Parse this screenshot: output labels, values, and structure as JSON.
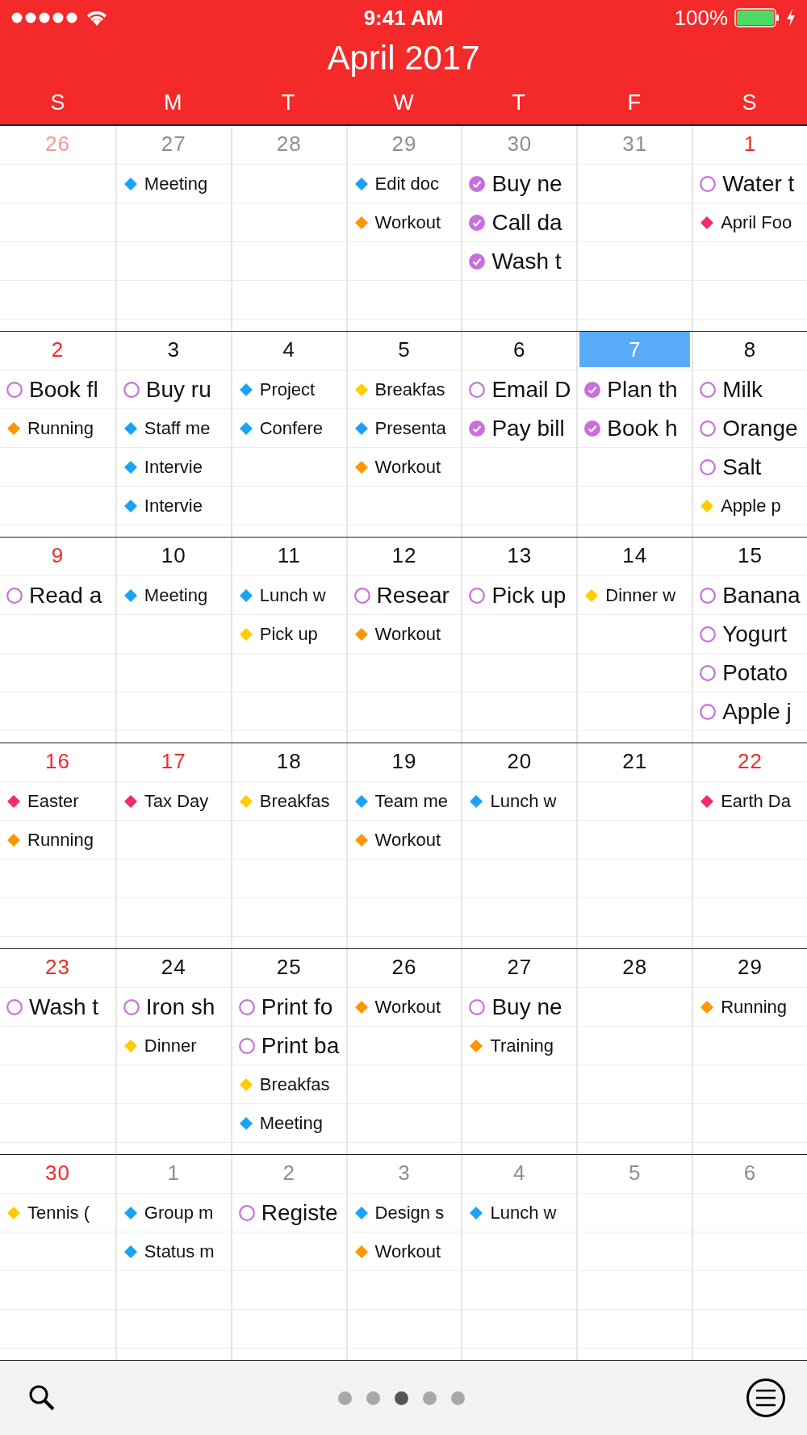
{
  "status_bar": {
    "time": "9:41 AM",
    "battery": "100%"
  },
  "header": {
    "title": "April 2017",
    "weekdays": [
      "S",
      "M",
      "T",
      "W",
      "T",
      "F",
      "S"
    ]
  },
  "weeks": [
    {
      "days": [
        {
          "number": "26",
          "other_month": true,
          "red": true,
          "selected": false
        },
        {
          "number": "27",
          "other_month": true,
          "red": false,
          "selected": false,
          "items": [
            {
              "kind": "event",
              "color": "#1aa3f5",
              "text": "Meeting"
            }
          ]
        },
        {
          "number": "28",
          "other_month": true,
          "red": false,
          "selected": false
        },
        {
          "number": "29",
          "other_month": true,
          "red": false,
          "selected": false,
          "items": [
            {
              "kind": "event",
              "color": "#1aa3f5",
              "text": "Edit doc"
            },
            {
              "kind": "event",
              "color": "#ff9500",
              "text": "Workout"
            }
          ]
        },
        {
          "number": "30",
          "other_month": true,
          "red": false,
          "selected": false,
          "items": [
            {
              "kind": "task",
              "done": true,
              "text": "Buy ne"
            },
            {
              "kind": "task",
              "done": true,
              "text": "Call da"
            },
            {
              "kind": "task",
              "done": true,
              "text": "Wash t"
            }
          ]
        },
        {
          "number": "31",
          "other_month": true,
          "red": false,
          "selected": false
        },
        {
          "number": "1",
          "other_month": false,
          "red": true,
          "selected": false,
          "items": [
            {
              "kind": "task",
              "done": false,
              "text": "Water t"
            },
            {
              "kind": "event",
              "color": "#f52b67",
              "text": "April Foo"
            }
          ]
        }
      ]
    },
    {
      "days": [
        {
          "number": "2",
          "other_month": false,
          "red": true,
          "selected": false,
          "items": [
            {
              "kind": "task",
              "done": false,
              "text": "Book fl"
            },
            {
              "kind": "event",
              "color": "#ff9500",
              "text": "Running"
            }
          ]
        },
        {
          "number": "3",
          "other_month": false,
          "red": false,
          "selected": false,
          "items": [
            {
              "kind": "task",
              "done": false,
              "text": "Buy ru"
            },
            {
              "kind": "event",
              "color": "#1aa3f5",
              "text": "Staff me"
            },
            {
              "kind": "event",
              "color": "#1aa3f5",
              "text": "Intervie"
            },
            {
              "kind": "event",
              "color": "#1aa3f5",
              "text": "Intervie"
            }
          ]
        },
        {
          "number": "4",
          "other_month": false,
          "red": false,
          "selected": false,
          "items": [
            {
              "kind": "event",
              "color": "#1aa3f5",
              "text": "Project"
            },
            {
              "kind": "event",
              "color": "#1aa3f5",
              "text": "Confere"
            }
          ]
        },
        {
          "number": "5",
          "other_month": false,
          "red": false,
          "selected": false,
          "items": [
            {
              "kind": "event",
              "color": "#ffcc00",
              "text": "Breakfas"
            },
            {
              "kind": "event",
              "color": "#1aa3f5",
              "text": "Presenta"
            },
            {
              "kind": "event",
              "color": "#ff9500",
              "text": "Workout"
            }
          ]
        },
        {
          "number": "6",
          "other_month": false,
          "red": false,
          "selected": false,
          "items": [
            {
              "kind": "task",
              "done": false,
              "text": "Email D"
            },
            {
              "kind": "task",
              "done": true,
              "text": "Pay bill"
            }
          ]
        },
        {
          "number": "7",
          "other_month": false,
          "red": false,
          "selected": true,
          "items": [
            {
              "kind": "task",
              "done": true,
              "text": "Plan th"
            },
            {
              "kind": "task",
              "done": true,
              "text": "Book h"
            }
          ]
        },
        {
          "number": "8",
          "other_month": false,
          "red": false,
          "selected": false,
          "items": [
            {
              "kind": "task",
              "done": false,
              "text": "Milk"
            },
            {
              "kind": "task",
              "done": false,
              "text": "Orange"
            },
            {
              "kind": "task",
              "done": false,
              "text": "Salt"
            },
            {
              "kind": "event",
              "color": "#ffcc00",
              "text": "Apple p"
            }
          ]
        }
      ]
    },
    {
      "days": [
        {
          "number": "9",
          "other_month": false,
          "red": true,
          "selected": false,
          "items": [
            {
              "kind": "task",
              "done": false,
              "text": "Read a"
            }
          ]
        },
        {
          "number": "10",
          "other_month": false,
          "red": false,
          "selected": false,
          "items": [
            {
              "kind": "event",
              "color": "#1aa3f5",
              "text": "Meeting"
            }
          ]
        },
        {
          "number": "11",
          "other_month": false,
          "red": false,
          "selected": false,
          "items": [
            {
              "kind": "event",
              "color": "#1aa3f5",
              "text": "Lunch w"
            },
            {
              "kind": "event",
              "color": "#ffcc00",
              "text": "Pick up"
            }
          ]
        },
        {
          "number": "12",
          "other_month": false,
          "red": false,
          "selected": false,
          "items": [
            {
              "kind": "task",
              "done": false,
              "text": "Resear"
            },
            {
              "kind": "event",
              "color": "#ff9500",
              "text": "Workout"
            }
          ]
        },
        {
          "number": "13",
          "other_month": false,
          "red": false,
          "selected": false,
          "items": [
            {
              "kind": "task",
              "done": false,
              "text": "Pick up"
            }
          ]
        },
        {
          "number": "14",
          "other_month": false,
          "red": false,
          "selected": false,
          "items": [
            {
              "kind": "event",
              "color": "#ffcc00",
              "text": "Dinner w"
            }
          ]
        },
        {
          "number": "15",
          "other_month": false,
          "red": false,
          "selected": false,
          "items": [
            {
              "kind": "task",
              "done": false,
              "text": "Banana"
            },
            {
              "kind": "task",
              "done": false,
              "text": "Yogurt"
            },
            {
              "kind": "task",
              "done": false,
              "text": "Potato"
            },
            {
              "kind": "task",
              "done": false,
              "text": "Apple j"
            }
          ]
        }
      ]
    },
    {
      "days": [
        {
          "number": "16",
          "other_month": false,
          "red": true,
          "selected": false,
          "items": [
            {
              "kind": "event",
              "color": "#f52b67",
              "text": "Easter"
            },
            {
              "kind": "event",
              "color": "#ff9500",
              "text": "Running"
            }
          ]
        },
        {
          "number": "17",
          "other_month": false,
          "red": true,
          "selected": false,
          "items": [
            {
              "kind": "event",
              "color": "#f52b67",
              "text": "Tax Day"
            }
          ]
        },
        {
          "number": "18",
          "other_month": false,
          "red": false,
          "selected": false,
          "items": [
            {
              "kind": "event",
              "color": "#ffcc00",
              "text": "Breakfas"
            }
          ]
        },
        {
          "number": "19",
          "other_month": false,
          "red": false,
          "selected": false,
          "items": [
            {
              "kind": "event",
              "color": "#1aa3f5",
              "text": "Team me"
            },
            {
              "kind": "event",
              "color": "#ff9500",
              "text": "Workout"
            }
          ]
        },
        {
          "number": "20",
          "other_month": false,
          "red": false,
          "selected": false,
          "items": [
            {
              "kind": "event",
              "color": "#1aa3f5",
              "text": "Lunch w"
            }
          ]
        },
        {
          "number": "21",
          "other_month": false,
          "red": false,
          "selected": false
        },
        {
          "number": "22",
          "other_month": false,
          "red": true,
          "selected": false,
          "items": [
            {
              "kind": "event",
              "color": "#f52b67",
              "text": "Earth Da"
            }
          ]
        }
      ]
    },
    {
      "days": [
        {
          "number": "23",
          "other_month": false,
          "red": true,
          "selected": false,
          "items": [
            {
              "kind": "task",
              "done": false,
              "text": "Wash t"
            }
          ]
        },
        {
          "number": "24",
          "other_month": false,
          "red": false,
          "selected": false,
          "items": [
            {
              "kind": "task",
              "done": false,
              "text": "Iron sh"
            },
            {
              "kind": "event",
              "color": "#ffcc00",
              "text": "Dinner"
            }
          ]
        },
        {
          "number": "25",
          "other_month": false,
          "red": false,
          "selected": false,
          "items": [
            {
              "kind": "task",
              "done": false,
              "text": "Print fo"
            },
            {
              "kind": "task",
              "done": false,
              "text": "Print ba"
            },
            {
              "kind": "event",
              "color": "#ffcc00",
              "text": "Breakfas"
            },
            {
              "kind": "event",
              "color": "#1aa3f5",
              "text": "Meeting"
            }
          ]
        },
        {
          "number": "26",
          "other_month": false,
          "red": false,
          "selected": false,
          "items": [
            {
              "kind": "event",
              "color": "#ff9500",
              "text": "Workout"
            }
          ]
        },
        {
          "number": "27",
          "other_month": false,
          "red": false,
          "selected": false,
          "items": [
            {
              "kind": "task",
              "done": false,
              "text": "Buy ne"
            },
            {
              "kind": "event",
              "color": "#ff9500",
              "text": "Training"
            }
          ]
        },
        {
          "number": "28",
          "other_month": false,
          "red": false,
          "selected": false
        },
        {
          "number": "29",
          "other_month": false,
          "red": false,
          "selected": false,
          "items": [
            {
              "kind": "event",
              "color": "#ff9500",
              "text": "Running"
            }
          ]
        }
      ]
    },
    {
      "days": [
        {
          "number": "30",
          "other_month": false,
          "red": true,
          "selected": false,
          "items": [
            {
              "kind": "event",
              "color": "#ffcc00",
              "text": "Tennis ("
            }
          ]
        },
        {
          "number": "1",
          "other_month": true,
          "red": false,
          "selected": false,
          "items": [
            {
              "kind": "event",
              "color": "#1aa3f5",
              "text": "Group m"
            },
            {
              "kind": "event",
              "color": "#1aa3f5",
              "text": "Status m"
            }
          ]
        },
        {
          "number": "2",
          "other_month": true,
          "red": false,
          "selected": false,
          "items": [
            {
              "kind": "task",
              "done": false,
              "text": "Registe"
            }
          ]
        },
        {
          "number": "3",
          "other_month": true,
          "red": false,
          "selected": false,
          "items": [
            {
              "kind": "event",
              "color": "#1aa3f5",
              "text": "Design s"
            },
            {
              "kind": "event",
              "color": "#ff9500",
              "text": "Workout"
            }
          ]
        },
        {
          "number": "4",
          "other_month": true,
          "red": false,
          "selected": false,
          "items": [
            {
              "kind": "event",
              "color": "#1aa3f5",
              "text": "Lunch w"
            }
          ]
        },
        {
          "number": "5",
          "other_month": true,
          "red": false,
          "selected": false
        },
        {
          "number": "6",
          "other_month": true,
          "red": false,
          "selected": false
        }
      ]
    }
  ],
  "page_dots": [
    {
      "selected": false
    },
    {
      "selected": false
    },
    {
      "selected": true
    },
    {
      "selected": false
    },
    {
      "selected": false
    }
  ]
}
